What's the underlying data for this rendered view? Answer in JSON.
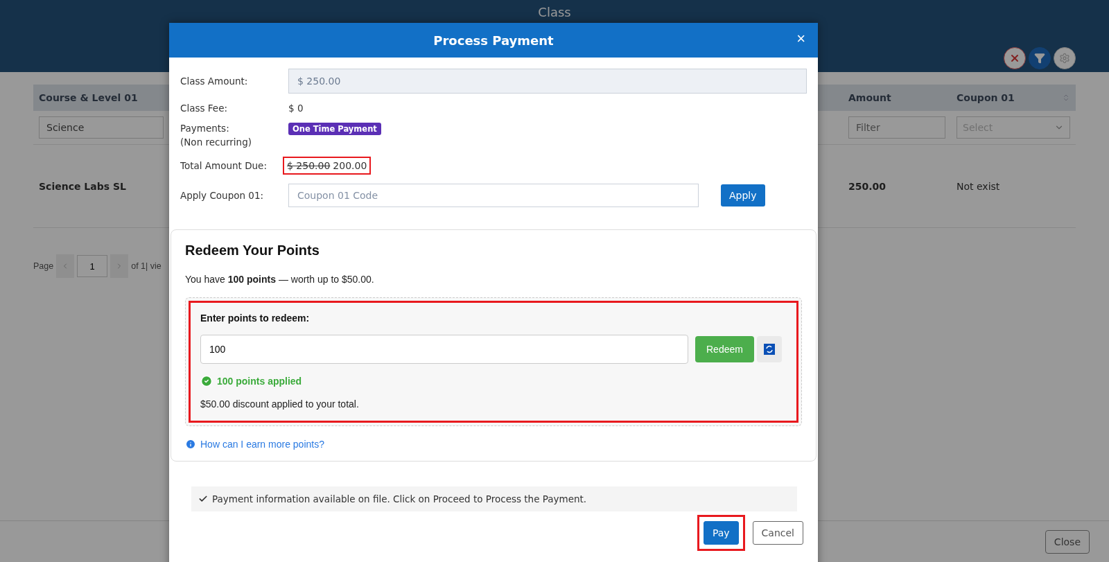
{
  "page": {
    "title": "Class",
    "toolbar": [
      {
        "kind": "clear"
      },
      {
        "kind": "filter"
      },
      {
        "kind": "settings"
      }
    ],
    "table": {
      "columns": [
        {
          "label": "Course & Level 01",
          "filter": {
            "kind": "input",
            "value": "Science"
          }
        },
        {
          "label": "Amount",
          "filter": {
            "kind": "input",
            "placeholder": "Filter"
          }
        },
        {
          "label": "Coupon 01",
          "filter": {
            "kind": "select",
            "placeholder": "Select"
          },
          "sortable": true
        }
      ],
      "rows": [
        [
          "Science Labs SL",
          "250.00",
          "Not exist"
        ]
      ]
    },
    "pagination": {
      "label": "Page",
      "page": "1",
      "total": "of 1| vie"
    },
    "footer": {
      "close": "Close"
    }
  },
  "dialog": {
    "title": "Process Payment",
    "close": "×",
    "class_amount": {
      "label": "Class Amount:",
      "value": "$ 250.00"
    },
    "class_fee": {
      "label": "Class Fee:",
      "value": "$ 0"
    },
    "payments": {
      "label": "Payments:",
      "sublabel": "(Non recurring)",
      "badge": "One Time Payment"
    },
    "total": {
      "label": "Total Amount Due:",
      "old": "$ 250.00",
      "new": "200.00",
      "highlighted": true
    },
    "coupon": {
      "label": "Apply Coupon 01:",
      "placeholder": "Coupon 01 Code",
      "button": "Apply"
    },
    "redeem": {
      "title": "Redeem Your Points",
      "summary": "You have **100 points** — worth up to $50.00.",
      "panel": {
        "highlighted": true,
        "label": "Enter points to redeem:",
        "value": "100",
        "button": "Redeem",
        "status": "100 points applied",
        "note": "$50.00 discount applied to your total."
      },
      "link": "How can I earn more points?"
    },
    "info": "Payment information available on file. Click on Proceed to Process the Payment.",
    "buttons": [
      {
        "label": "Pay",
        "kind": "primary",
        "highlighted": true
      },
      {
        "label": "Cancel",
        "kind": "secondary",
        "highlighted": false
      }
    ]
  }
}
